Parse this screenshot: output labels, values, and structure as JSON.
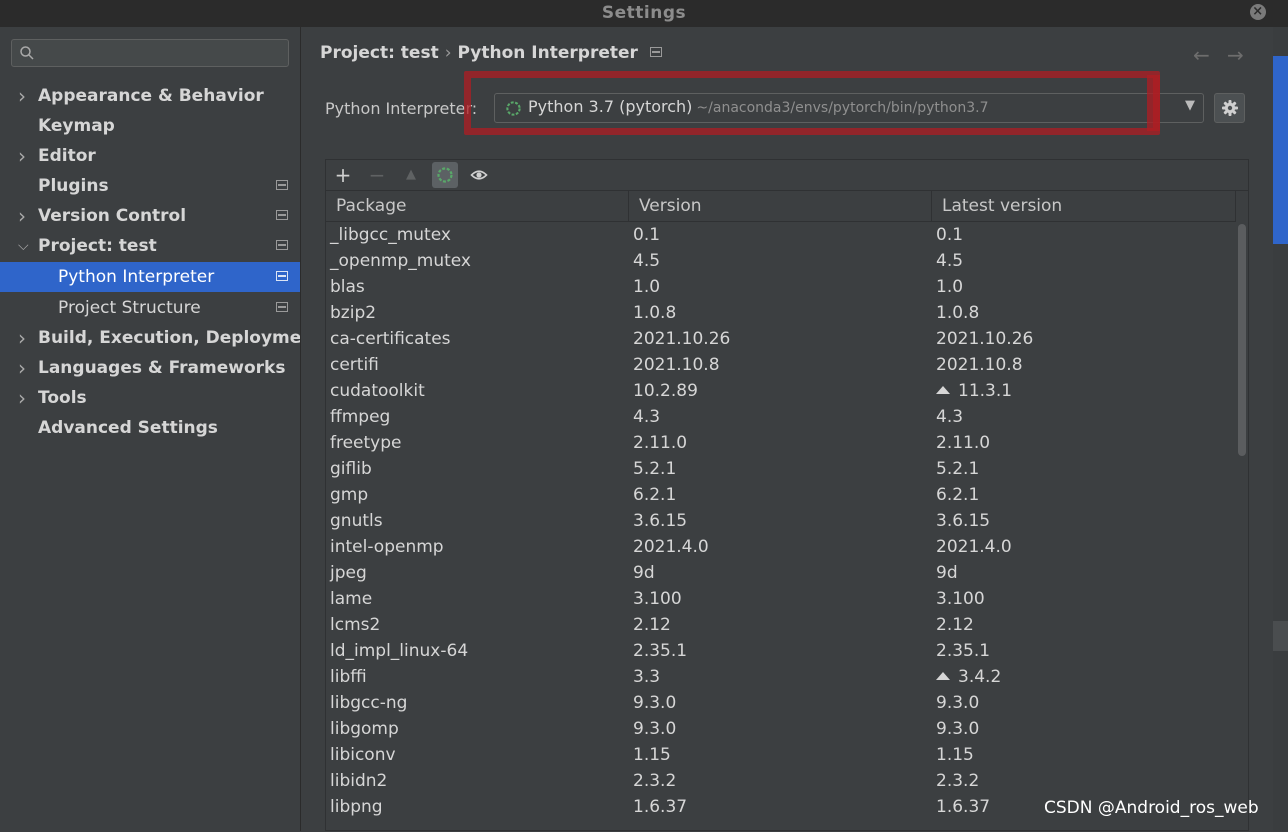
{
  "window": {
    "title": "Settings"
  },
  "sidebar": {
    "search_placeholder": "",
    "items": [
      {
        "label": "Appearance & Behavior",
        "expandable": true,
        "expanded": false,
        "project_icon": false
      },
      {
        "label": "Keymap",
        "expandable": false,
        "project_icon": false
      },
      {
        "label": "Editor",
        "expandable": true,
        "expanded": false,
        "project_icon": false
      },
      {
        "label": "Plugins",
        "expandable": false,
        "project_icon": true
      },
      {
        "label": "Version Control",
        "expandable": true,
        "expanded": false,
        "project_icon": true
      },
      {
        "label": "Project: test",
        "expandable": true,
        "expanded": true,
        "project_icon": true
      },
      {
        "label": "Python Interpreter",
        "child": true,
        "selected": true,
        "project_icon": true
      },
      {
        "label": "Project Structure",
        "child": true,
        "project_icon": true
      },
      {
        "label": "Build, Execution, Deployment",
        "expandable": true,
        "expanded": false,
        "project_icon": false
      },
      {
        "label": "Languages & Frameworks",
        "expandable": true,
        "expanded": false,
        "project_icon": false
      },
      {
        "label": "Tools",
        "expandable": true,
        "expanded": false,
        "project_icon": false
      },
      {
        "label": "Advanced Settings",
        "expandable": false,
        "project_icon": false
      }
    ]
  },
  "main": {
    "breadcrumb": {
      "parent": "Project: test",
      "separator": "›",
      "current": "Python Interpreter"
    },
    "nav": {
      "back": "←",
      "forward": "→"
    },
    "interpreter": {
      "label": "Python Interpreter:",
      "name": "Python 3.7 (pytorch)",
      "path": "~/anaconda3/envs/pytorch/bin/python3.7",
      "dropdown_arrow": "▼"
    },
    "toolbar": {
      "add": "+",
      "remove": "−",
      "upgrade": "▲"
    },
    "table": {
      "columns": [
        "Package",
        "Version",
        "Latest version"
      ],
      "rows": [
        {
          "package": "_libgcc_mutex",
          "version": "0.1",
          "latest": "0.1",
          "upgrade": false
        },
        {
          "package": "_openmp_mutex",
          "version": "4.5",
          "latest": "4.5",
          "upgrade": false
        },
        {
          "package": "blas",
          "version": "1.0",
          "latest": "1.0",
          "upgrade": false
        },
        {
          "package": "bzip2",
          "version": "1.0.8",
          "latest": "1.0.8",
          "upgrade": false
        },
        {
          "package": "ca-certificates",
          "version": "2021.10.26",
          "latest": "2021.10.26",
          "upgrade": false
        },
        {
          "package": "certifi",
          "version": "2021.10.8",
          "latest": "2021.10.8",
          "upgrade": false
        },
        {
          "package": "cudatoolkit",
          "version": "10.2.89",
          "latest": "11.3.1",
          "upgrade": true
        },
        {
          "package": "ffmpeg",
          "version": "4.3",
          "latest": "4.3",
          "upgrade": false
        },
        {
          "package": "freetype",
          "version": "2.11.0",
          "latest": "2.11.0",
          "upgrade": false
        },
        {
          "package": "giflib",
          "version": "5.2.1",
          "latest": "5.2.1",
          "upgrade": false
        },
        {
          "package": "gmp",
          "version": "6.2.1",
          "latest": "6.2.1",
          "upgrade": false
        },
        {
          "package": "gnutls",
          "version": "3.6.15",
          "latest": "3.6.15",
          "upgrade": false
        },
        {
          "package": "intel-openmp",
          "version": "2021.4.0",
          "latest": "2021.4.0",
          "upgrade": false
        },
        {
          "package": "jpeg",
          "version": "9d",
          "latest": "9d",
          "upgrade": false
        },
        {
          "package": "lame",
          "version": "3.100",
          "latest": "3.100",
          "upgrade": false
        },
        {
          "package": "lcms2",
          "version": "2.12",
          "latest": "2.12",
          "upgrade": false
        },
        {
          "package": "ld_impl_linux-64",
          "version": "2.35.1",
          "latest": "2.35.1",
          "upgrade": false
        },
        {
          "package": "libffi",
          "version": "3.3",
          "latest": "3.4.2",
          "upgrade": true
        },
        {
          "package": "libgcc-ng",
          "version": "9.3.0",
          "latest": "9.3.0",
          "upgrade": false
        },
        {
          "package": "libgomp",
          "version": "9.3.0",
          "latest": "9.3.0",
          "upgrade": false
        },
        {
          "package": "libiconv",
          "version": "1.15",
          "latest": "1.15",
          "upgrade": false
        },
        {
          "package": "libidn2",
          "version": "2.3.2",
          "latest": "2.3.2",
          "upgrade": false
        },
        {
          "package": "libpng",
          "version": "1.6.37",
          "latest": "1.6.37",
          "upgrade": false
        }
      ]
    }
  },
  "watermark": "CSDN @Android_ros_web",
  "colors": {
    "selection": "#2f65ca",
    "annotation_red": "#af1e23",
    "spinner_green": "#59a869",
    "background": "#3c3f41"
  }
}
